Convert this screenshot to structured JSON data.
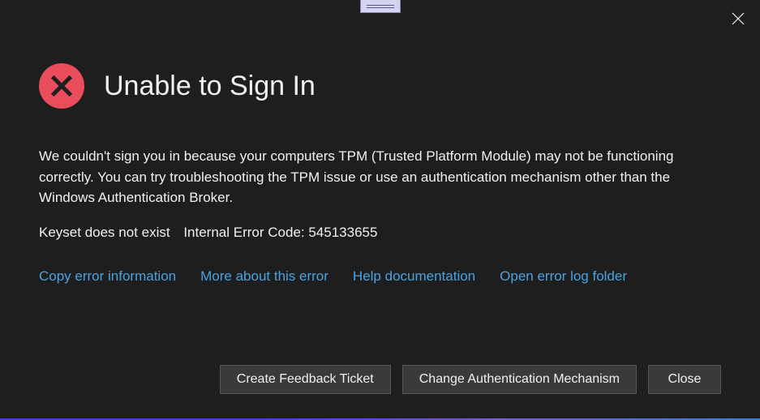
{
  "dialog": {
    "title": "Unable to Sign In",
    "body": "We couldn't sign you in because your computers TPM (Trusted Platform Module) may not be functioning correctly. You can try troubleshooting the TPM issue or use an authentication mechanism other than the Windows Authentication Broker.",
    "error_message": "Keyset does not exist",
    "error_code_label": "Internal Error Code: 545133655"
  },
  "links": {
    "copy_error": "Copy error information",
    "more_about": "More about this error",
    "help_docs": "Help documentation",
    "open_log": "Open error log folder"
  },
  "buttons": {
    "create_feedback": "Create Feedback Ticket",
    "change_auth": "Change Authentication Mechanism",
    "close": "Close"
  },
  "colors": {
    "error_badge": "#e94c5b",
    "link": "#4aa3df",
    "background": "#1e1e1e"
  }
}
